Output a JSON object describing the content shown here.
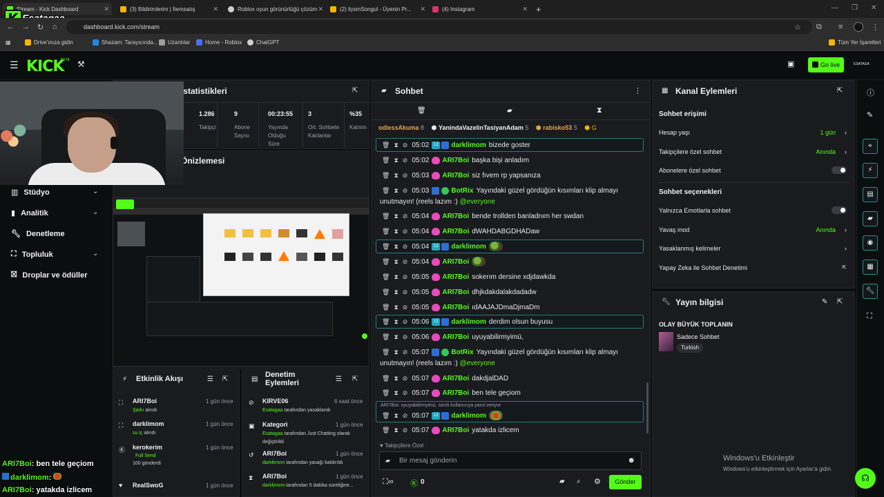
{
  "browser": {
    "tabs": [
      {
        "label": "Stream - Kick Dashboard",
        "color": "#53fc18",
        "active": true
      },
      {
        "label": "(3) Bildirimlerim | İtemsatış",
        "color": "#f5b400",
        "active": false
      },
      {
        "label": "Roblox oyun görünürlüğü çözüm",
        "color": "#cfcfcf",
        "active": false
      },
      {
        "label": "(2) ilysmSongul - Üyenin Pr...",
        "color": "#f5b400",
        "active": false
      },
      {
        "label": "(4) Instagram",
        "color": "#e1306c",
        "active": false
      }
    ],
    "url": "dashboard.kick.com/stream",
    "bookmarks": [
      "Drive'ınıza gidin",
      "Shazam: Tarayıcında...",
      "Uzantılar",
      "Home - Roblox",
      "ChatGPT"
    ],
    "all_bookmarks": "Tüm Yer İşaretleri"
  },
  "header": {
    "logo": "KICK",
    "beta": "BETA",
    "go_live": "Go live",
    "username_short": "ESATAGA"
  },
  "overlay": {
    "channel_name": "Esatagaa",
    "chat_lines": [
      {
        "user": "ARI7Boi",
        "text": ": ben tele geçiom"
      },
      {
        "user": "darklimom",
        "text": ": "
      },
      {
        "user": "ARI7Boi",
        "text": ": yatakda izlicem"
      }
    ]
  },
  "stats": {
    "title": "İstatistikleri",
    "items": [
      {
        "value": "1.286",
        "label": "Takipçi"
      },
      {
        "value": "9",
        "label": "Abone Sayısı"
      },
      {
        "value": "00:23:55",
        "label": "Yayında Olduğu Süre"
      },
      {
        "value": "3",
        "label": "Ort. Sohbete Katılanlar"
      },
      {
        "value": "%35",
        "label": "Katılım"
      }
    ],
    "section2": "Önizlemesi"
  },
  "sidebar": {
    "items": [
      {
        "label": "Stüdyo",
        "chevron": true
      },
      {
        "label": "Analitik",
        "chevron": true
      },
      {
        "label": "Denetleme",
        "chevron": false
      },
      {
        "label": "Topluluk",
        "chevron": true
      },
      {
        "label": "Droplar ve ödüller",
        "chevron": false
      }
    ]
  },
  "activity": {
    "title": "Etkinlik Akışı",
    "items": [
      {
        "name": "ARI7Boi",
        "time": "1 gün önce",
        "sub": "Şarkı",
        "sub2": " alındı"
      },
      {
        "name": "darklimom",
        "time": "1 gün önce",
        "sub": "su iç",
        "sub2": " alındı"
      },
      {
        "name": "kerokerim",
        "time": "1 gün önce",
        "sub": "Full Send",
        "sub2": "100 gönderdi"
      },
      {
        "name": "RealSwoG",
        "time": "1 gün önce",
        "sub": "",
        "sub2": ""
      }
    ]
  },
  "moderation": {
    "title": "Denetim Eylemleri",
    "items": [
      {
        "name": "KIRVE06",
        "time": "6 saat önce",
        "who": "Esatagaa",
        "desc": " tarafından yasaklandı"
      },
      {
        "name": "Kategori",
        "time": "1 gün önce",
        "who": "Esatagaa",
        "desc": " tarafından Just Chatting olarak değiştirildi"
      },
      {
        "name": "ARI7Boi",
        "time": "1 gün önce",
        "who": "darklimom",
        "desc": " tarafından yasağı kaldırıldı"
      },
      {
        "name": "ARI7Boi",
        "time": "1 gün önce",
        "who": "darklimom",
        "desc": " tarafından 5 dakika süreliğine..."
      }
    ]
  },
  "chat": {
    "title": "Sohbet",
    "pinned_users": [
      {
        "name": "odlessAkuma",
        "count": "8"
      },
      {
        "name": "YanindaVazelinTasiyanAdam",
        "count": "5"
      },
      {
        "name": "rabisko53",
        "count": "5"
      }
    ],
    "messages": [
      {
        "time": "05:02",
        "user": "darklimom",
        "type": "mod",
        "text": "bizede goster",
        "hl": true
      },
      {
        "time": "05:02",
        "user": "ARI7Boi",
        "type": "sub",
        "text": "başka bişi anladım"
      },
      {
        "time": "05:03",
        "user": "ARI7Boi",
        "type": "sub",
        "text": "siz fıvem rp yapsanıza"
      },
      {
        "time": "05:03",
        "user": "BotRix",
        "type": "bot",
        "text": "Yayındaki güzel gördüğün kısımları klip almayı",
        "text2": "unutmayın! (reels lazım :)",
        "mention": "@everyone"
      },
      {
        "time": "05:04",
        "user": "ARI7Boi",
        "type": "sub",
        "text": "bende trollden banladnım her swdan"
      },
      {
        "time": "05:04",
        "user": "ARI7Boi",
        "type": "sub",
        "text": "dWAHDABGDHADaw"
      },
      {
        "time": "05:04",
        "user": "darklimom",
        "type": "mod",
        "text": "",
        "emote": true,
        "hl": true
      },
      {
        "time": "05:04",
        "user": "ARI7Boi",
        "type": "sub",
        "text": "",
        "emote": true
      },
      {
        "time": "05:05",
        "user": "ARI7Boi",
        "type": "sub",
        "text": "sokerım dersine xdjdawkda"
      },
      {
        "time": "05:05",
        "user": "ARI7Boi",
        "type": "sub",
        "text": "dhjkdakdalakdadadw"
      },
      {
        "time": "05:05",
        "user": "ARI7Boi",
        "type": "sub",
        "text": "ıdAAJAJDmaDjmaDm"
      },
      {
        "time": "05:06",
        "user": "darklimom",
        "type": "mod",
        "text": "derdim olsun buyusu",
        "hl": true
      },
      {
        "time": "05:06",
        "user": "ARI7Boi",
        "type": "sub",
        "text": "uyuyabilirmyimü,"
      },
      {
        "time": "05:07",
        "user": "BotRix",
        "type": "bot",
        "text": "Yayındaki güzel gördüğün kısımları klip almayı",
        "text2": "unutmayın! (reels lazım :)",
        "mention": "@everyone"
      },
      {
        "time": "05:07",
        "user": "ARI7Boi",
        "type": "sub",
        "text": "dakdjalDAD"
      },
      {
        "time": "05:07",
        "user": "ARI7Boi",
        "type": "sub",
        "text": "ben tele geçiom"
      },
      {
        "time": "05:07",
        "user": "darklimom",
        "type": "mod",
        "text": "",
        "emote": true,
        "hl": true,
        "reply": "ARI7Boi: uyuyabilirmyimü, isimli kullanıcıya yanıt veriyor"
      },
      {
        "time": "05:07",
        "user": "ARI7Boi",
        "type": "sub",
        "text": "yatakda izlicem"
      }
    ],
    "followers_only": "Takipçilere Özel",
    "input_placeholder": "Bir mesaj gönderin",
    "points": "0",
    "send": "Gönder"
  },
  "channel_actions": {
    "title": "Kanal Eylemleri",
    "chat_access": "Sohbet erişimi",
    "rows_access": [
      {
        "label": "Hesap yaşı",
        "value": "1 gün",
        "kind": "arrow"
      },
      {
        "label": "Takipçilere özel sohbet",
        "value": "Anında",
        "kind": "arrow"
      },
      {
        "label": "Abonelere özel sohbet",
        "value": "",
        "kind": "toggle"
      }
    ],
    "chat_options": "Sohbet seçenekleri",
    "rows_options": [
      {
        "label": "Yalnızca Emotlarla sohbet",
        "value": "",
        "kind": "toggle"
      },
      {
        "label": "Yavaş mod",
        "value": "Anında",
        "kind": "arrow"
      },
      {
        "label": "Yasaklanmış kelimeler",
        "value": "",
        "kind": "arrow"
      },
      {
        "label": "Yapay Zeka ile Sohbet Denetimi",
        "value": "",
        "kind": "ext"
      }
    ]
  },
  "stream_info": {
    "title": "Yayın bilgisi",
    "stream_title": "OLAY BÜYÜK TOPLANIN",
    "category": "Sadece Sohbet",
    "tag": "Turkish"
  },
  "windows": {
    "activate": "Windows'u Etkinleştir",
    "activate_sub": "Windows'u etkinleştirmek için Ayarlar'a gidin."
  },
  "colors": {
    "accent": "#53fc18",
    "panel": "#191b1f",
    "bg": "#0b0e0f"
  }
}
